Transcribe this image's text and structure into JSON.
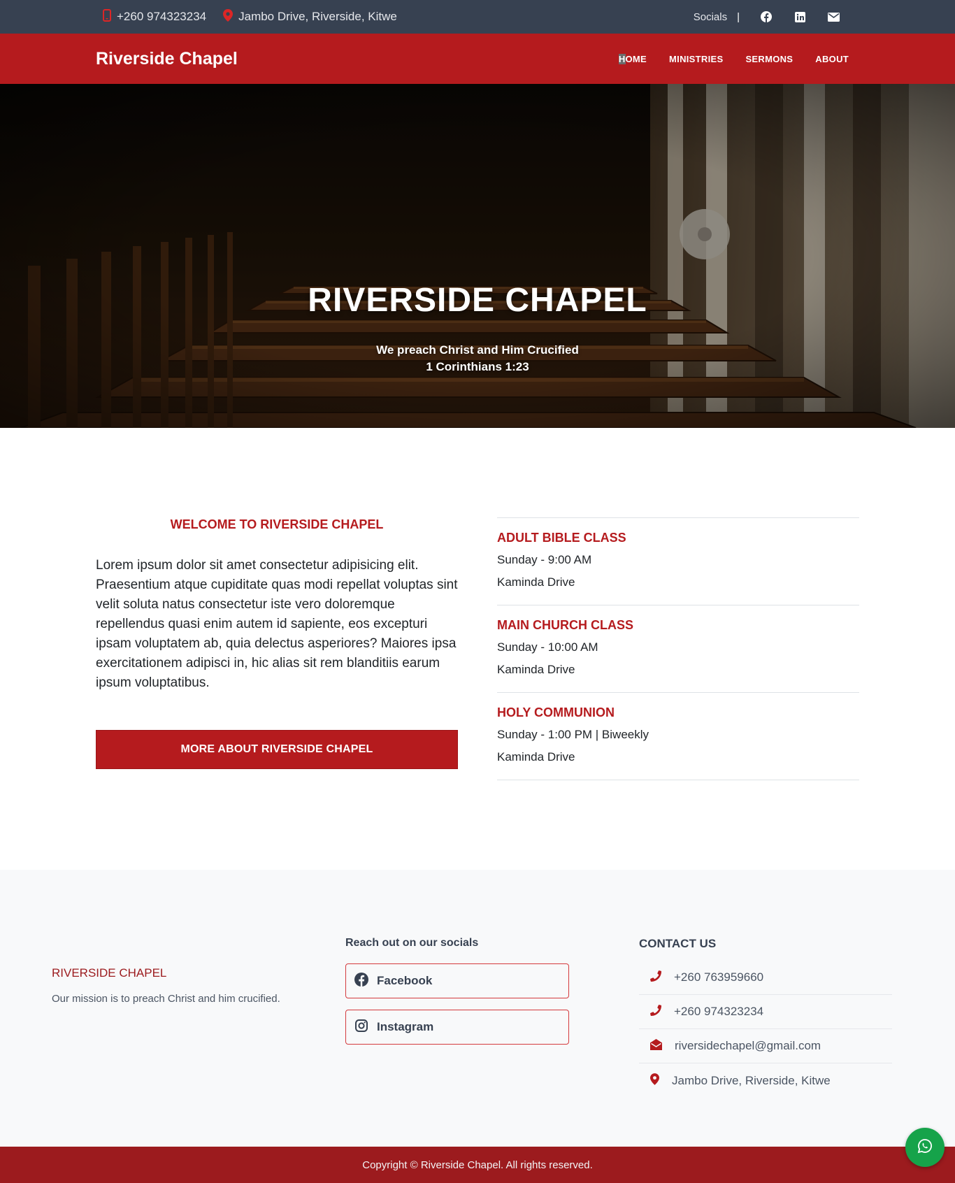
{
  "topbar": {
    "phone": "+260 974323234",
    "address": "Jambo Drive, Riverside, Kitwe",
    "socials_label": "Socials",
    "separator": "|",
    "icons": [
      "facebook-icon",
      "linkedin-icon",
      "envelope-icon"
    ]
  },
  "nav": {
    "brand": "Riverside Chapel",
    "items": [
      {
        "label": "HOME",
        "active": true
      },
      {
        "label": "MINISTRIES"
      },
      {
        "label": "SERMONS"
      },
      {
        "label": "ABOUT"
      }
    ]
  },
  "hero": {
    "title": "RIVERSIDE CHAPEL",
    "tagline": "We preach Christ and Him Crucified",
    "verse": "1 Corinthians 1:23"
  },
  "welcome": {
    "heading": "WELCOME TO RIVERSIDE CHAPEL",
    "body": "Lorem ipsum dolor sit amet consectetur adipisicing elit. Praesentium atque cupiditate quas modi repellat voluptas sint velit soluta natus consectetur iste vero doloremque repellendus quasi enim autem id sapiente, eos excepturi ipsam voluptatem ab, quia delectus asperiores? Maiores ipsa exercitationem adipisci in, hic alias sit rem blanditiis earum ipsum voluptatibus.",
    "button": "MORE ABOUT RIVERSIDE CHAPEL"
  },
  "services": [
    {
      "title": "ADULT BIBLE CLASS",
      "time": "Sunday - 9:00 AM",
      "location": "Kaminda Drive"
    },
    {
      "title": "MAIN CHURCH CLASS",
      "time": "Sunday - 10:00 AM",
      "location": "Kaminda Drive"
    },
    {
      "title": "HOLY COMMUNION",
      "time": "Sunday - 1:00 PM | Biweekly",
      "location": "Kaminda Drive"
    }
  ],
  "footer": {
    "about": {
      "title": "RIVERSIDE CHAPEL",
      "mission": "Our mission is to preach Christ and him crucified."
    },
    "socials": {
      "heading": "Reach out on our socials",
      "facebook": "Facebook",
      "instagram": "Instagram"
    },
    "contact": {
      "heading": "CONTACT US",
      "phone1": "+260 763959660",
      "phone2": "+260 974323234",
      "email": "riversidechapel@gmail.com",
      "address": "Jambo Drive, Riverside, Kitwe"
    },
    "copyright": "Copyright © Riverside Chapel. All rights reserved."
  },
  "colors": {
    "brand_red": "#b51b1e",
    "dark_red": "#9c1b1e",
    "topbar": "#374151",
    "whatsapp_green": "#16a34a"
  }
}
